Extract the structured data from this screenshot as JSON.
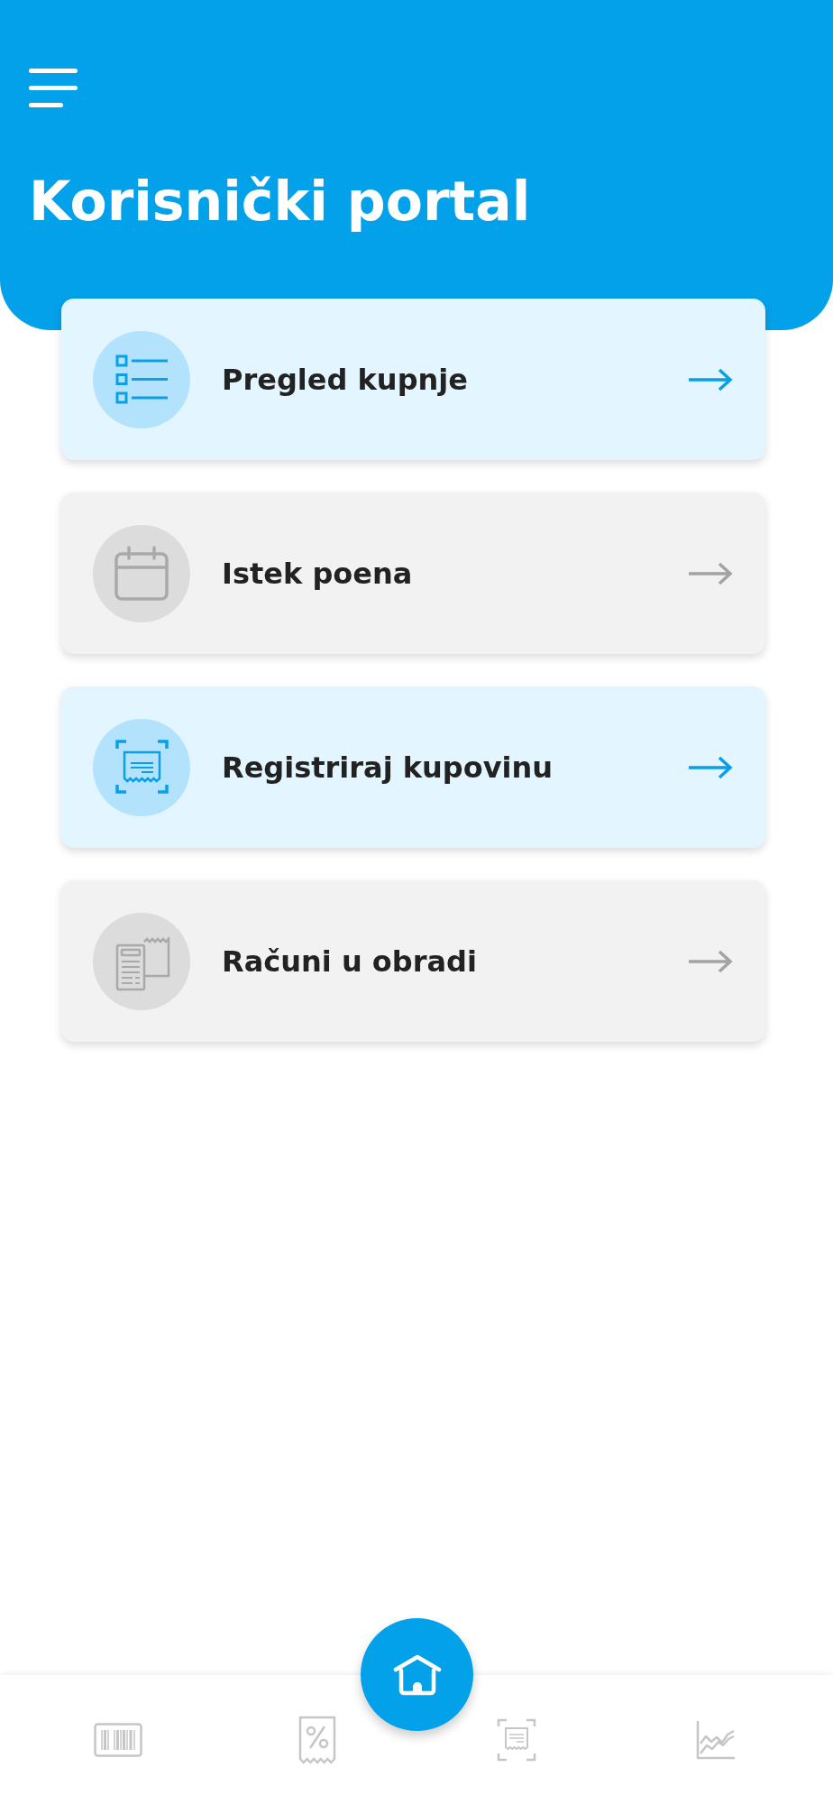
{
  "header": {
    "title": "Korisnički portal"
  },
  "menu_items": [
    {
      "label": "Pregled kupnje",
      "disabled": false
    },
    {
      "label": "Istek poena",
      "disabled": true
    },
    {
      "label": "Registriraj kupovinu",
      "disabled": false
    },
    {
      "label": "Računi u obradi",
      "disabled": true
    }
  ],
  "bottom_nav": {
    "tabs": [
      {
        "selected": false
      },
      {
        "selected": false
      },
      {
        "selected": false
      },
      {
        "selected": false
      }
    ],
    "home_button": {
      "selected": true
    }
  }
}
